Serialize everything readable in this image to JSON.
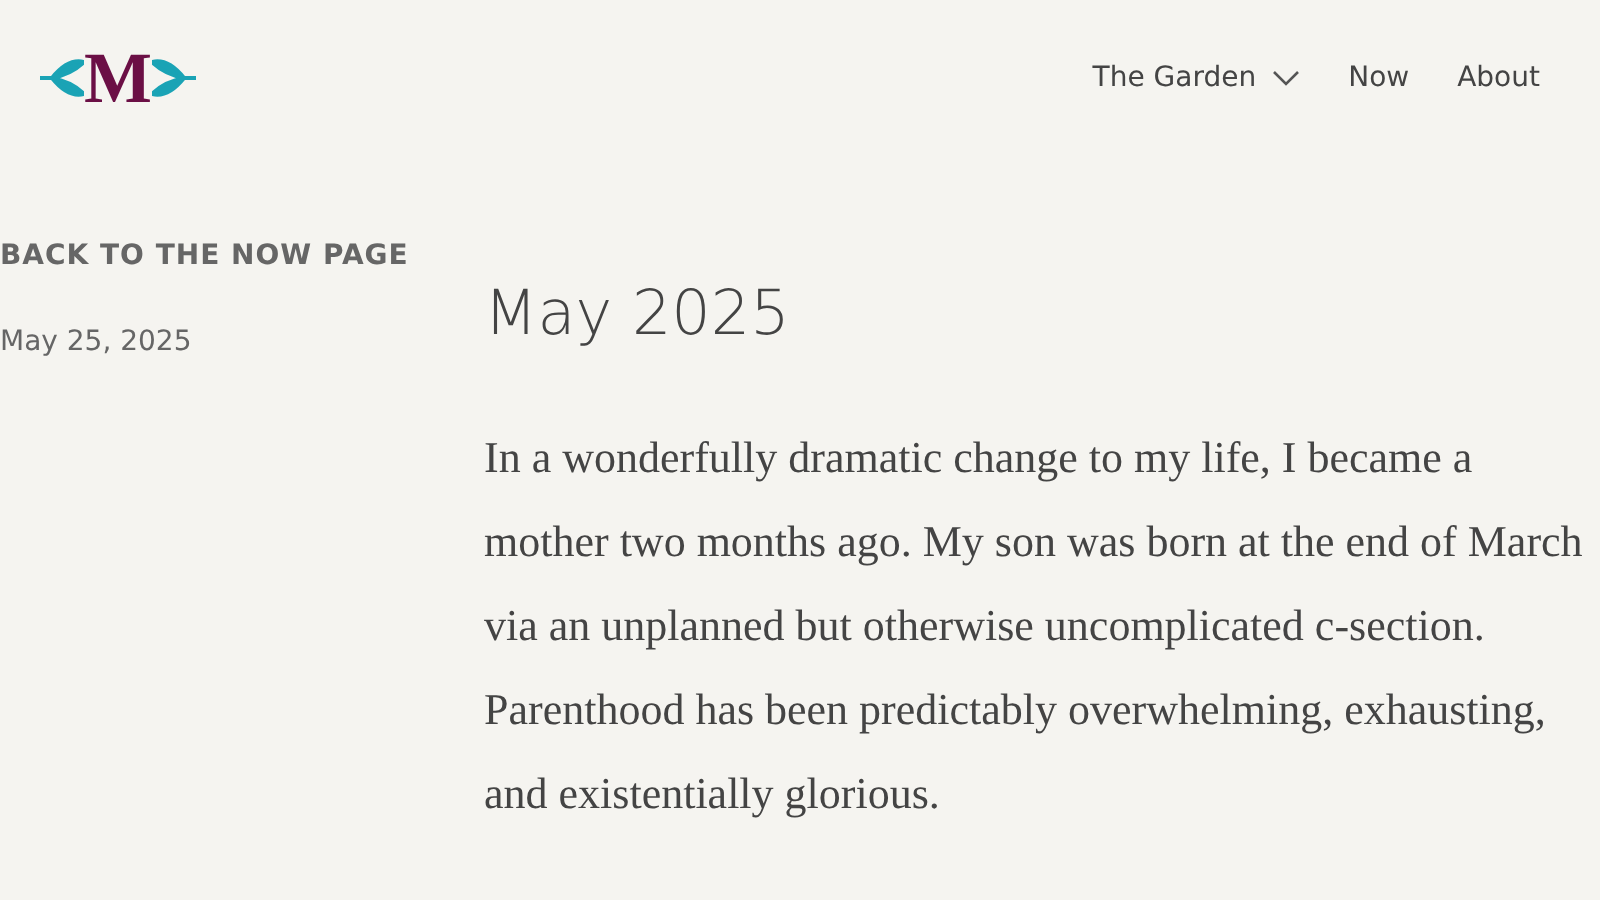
{
  "logo": {
    "letter": "M"
  },
  "nav": [
    {
      "label": "The Garden",
      "kind": "dropdown"
    },
    {
      "label": "Now",
      "kind": "link"
    },
    {
      "label": "About",
      "kind": "link"
    }
  ],
  "back_link": "BACK TO THE NOW PAGE",
  "post": {
    "date": "May 25, 2025",
    "title": "May 2025",
    "body": "In a wonderfully dramatic change to my life, I became a mother two months ago. My son was born at the end of March via an unplanned but otherwise uncomplicated c-section. Parenthood has been predictably overwhelming, exhausting, and existentially glorious."
  }
}
